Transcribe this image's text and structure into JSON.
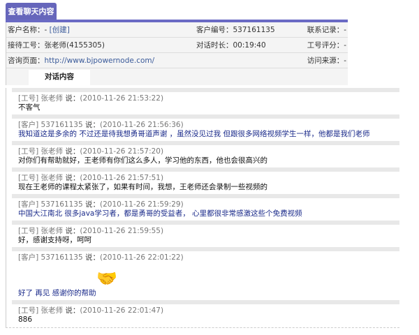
{
  "tab_title": "查看聊天内容",
  "info": {
    "customer_name_label": "客户名称：",
    "customer_name_value": "- ",
    "create_link": "[创建]",
    "customer_id_label": "客户编号：",
    "customer_id_value": "537161135",
    "contact_label": "联系记录：",
    "contact_value": "-",
    "agent_label": "接待工号：",
    "agent_value": "张老师(4155305)",
    "duration_label": "对话时长：",
    "duration_value": "00:19:40",
    "rating_label": "工号评分：",
    "rating_value": "-",
    "page_label": "咨询页面：",
    "page_value": "http://www.bjpowernode.com/",
    "source_label": "访问来源：",
    "source_value": "-"
  },
  "subtab": "对话内容",
  "says": " 说：",
  "messages": [
    {
      "who": "[工号] 张老师",
      "time": "(2010-11-26 21:53:22)",
      "text": "不客气",
      "type": "staff"
    },
    {
      "who": "[客户] 537161135",
      "time": "(2010-11-26 21:56:36)",
      "text": "我知道这是多余的 不过还是待我想勇哥道声谢 ，虽然没见过我 但跟很多网络视频学生一样，他都是我们老师",
      "type": "customer"
    },
    {
      "who": "[工号] 张老师",
      "time": "(2010-11-26 21:57:20)",
      "text": "对你们有帮助就好，王老师有你们这么多人，学习他的东西，他也会很高兴的",
      "type": "staff"
    },
    {
      "who": "[工号] 张老师",
      "time": "(2010-11-26 21:57:51)",
      "text": "现在王老师的课程太紧张了，如果有时间，我想，王老师还会录制一些视频的",
      "type": "staff"
    },
    {
      "who": "[客户] 537161135",
      "time": "(2010-11-26 21:59:29)",
      "text": "中国大江南北 很多java学习者，都是勇哥的受益者， 心里都很非常感激这些个免费视频",
      "type": "customer"
    },
    {
      "who": "[工号] 张老师",
      "time": "(2010-11-26 21:59:55)",
      "text": "好，感谢支持呀，呵呵",
      "type": "staff"
    },
    {
      "who": "[客户] 537161135",
      "time": "(2010-11-26 22:01:22)",
      "text": "好了 再见 感谢你的帮助",
      "type": "customer",
      "emoji": "handshake"
    },
    {
      "who": "[工号] 张老师",
      "time": "(2010-11-26 22:01:47)",
      "text": "886",
      "type": "staff"
    }
  ]
}
